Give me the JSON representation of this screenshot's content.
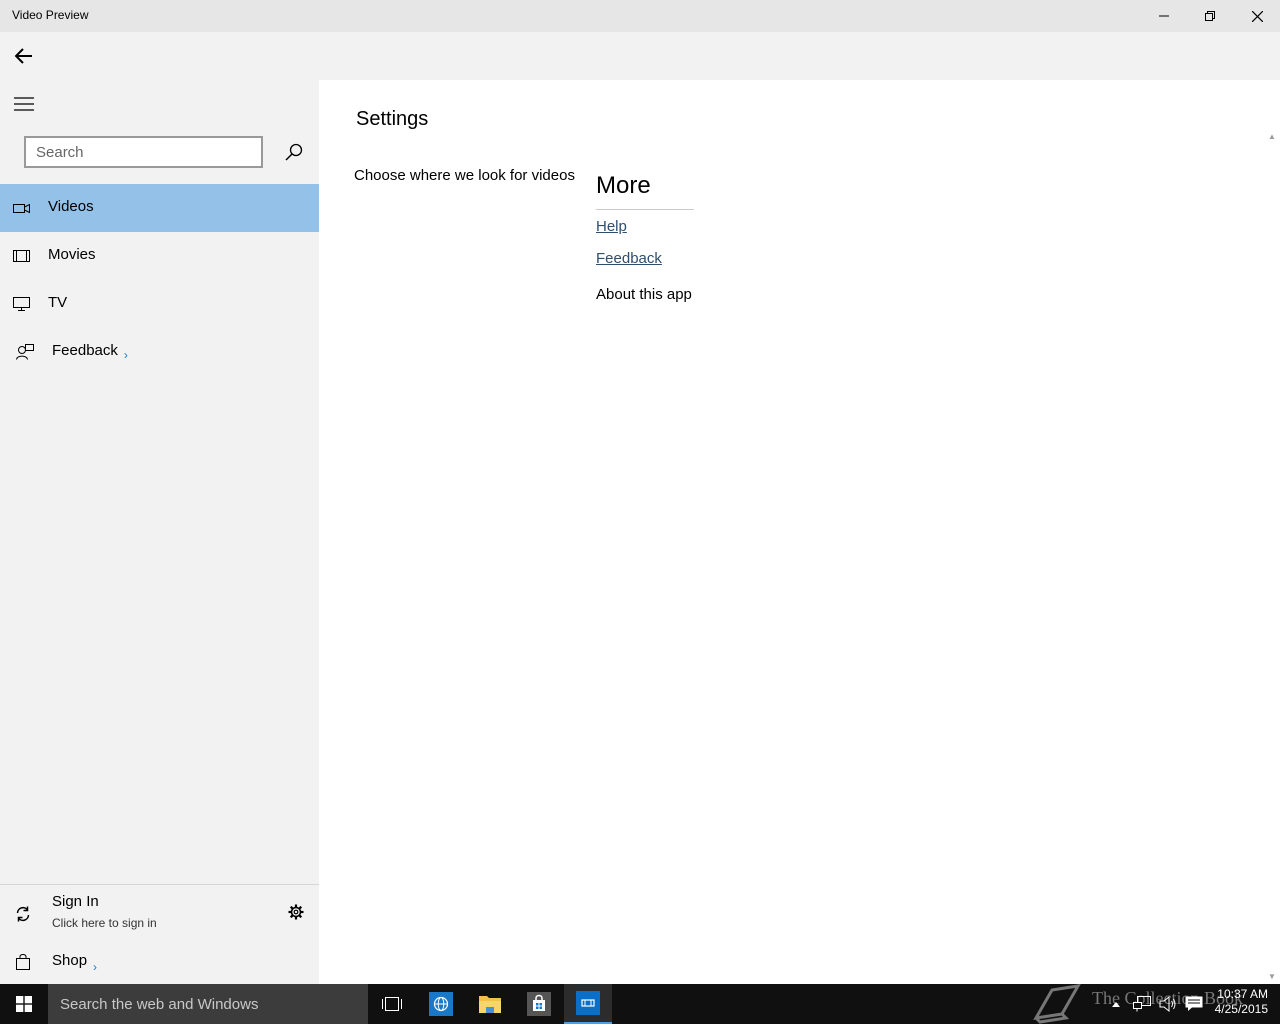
{
  "window": {
    "title": "Video Preview"
  },
  "sidebar": {
    "search_placeholder": "Search",
    "items": [
      {
        "label": "Videos",
        "icon": "video-camera-icon",
        "active": true
      },
      {
        "label": "Movies",
        "icon": "film-icon",
        "active": false
      },
      {
        "label": "TV",
        "icon": "monitor-icon",
        "active": false
      },
      {
        "label": "Feedback",
        "icon": "feedback-person-icon",
        "active": false,
        "chevron": "›"
      }
    ],
    "signin": {
      "label": "Sign In",
      "sub": "Click here to sign in"
    },
    "shop": {
      "label": "Shop",
      "chevron": "›"
    }
  },
  "main": {
    "title": "Settings",
    "choose_link": "Choose where we look for videos",
    "more": {
      "title": "More",
      "help": "Help",
      "feedback": "Feedback",
      "about": "About this app"
    }
  },
  "taskbar": {
    "search_placeholder": "Search the web and Windows",
    "watermark": "The Collection Book",
    "time": "10:37 AM",
    "date": "4/25/2015"
  },
  "colors": {
    "active_nav": "#94c1e8",
    "sidebar_bg": "#f2f2f2",
    "titlebar_bg": "#e6e6e6",
    "link": "#2e4e6e",
    "accent": "#1979ca",
    "taskbar_bg": "#101010"
  }
}
